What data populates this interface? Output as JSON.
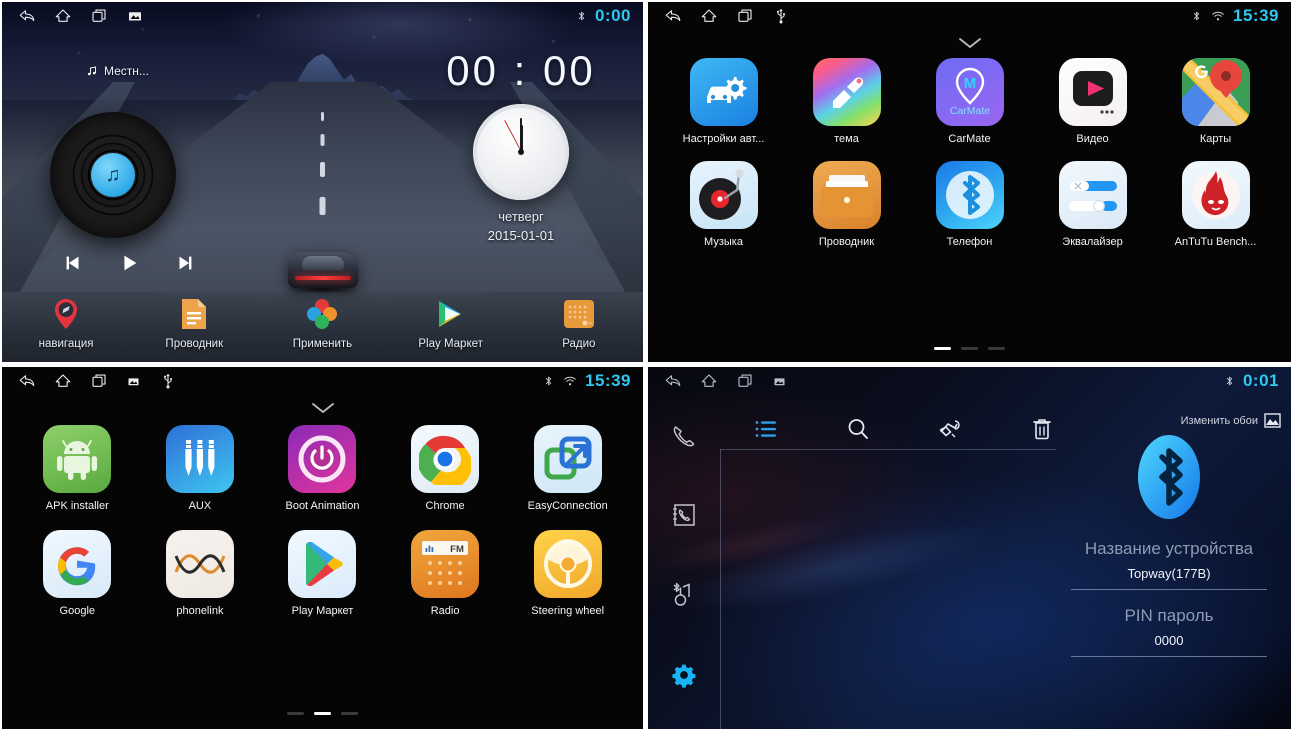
{
  "panels": {
    "home": {
      "statusbar": {
        "left_icons": [
          "back-icon",
          "home-icon",
          "recents-icon",
          "screenshot-icon"
        ],
        "right_icons": [
          "bluetooth-icon"
        ],
        "time": "0:00"
      },
      "now_playing": {
        "icon": "music-note-icon",
        "text": "Местн..."
      },
      "music_widget": {
        "disc_icon": "music-note-icon",
        "prev_label": "prev-track",
        "play_label": "play",
        "next_label": "next-track"
      },
      "clock_widget": {
        "digital_time": "00 : 00",
        "day_of_week": "четверг",
        "date": "2015-01-01"
      },
      "dock": [
        {
          "label": "навигация",
          "icon": "navigation-pin-icon"
        },
        {
          "label": "Проводник",
          "icon": "file-manager-icon"
        },
        {
          "label": "Применить",
          "icon": "apply-clover-icon"
        },
        {
          "label": "Play Маркет",
          "icon": "play-store-icon"
        },
        {
          "label": "Радио",
          "icon": "radio-icon"
        }
      ]
    },
    "drawer_page1": {
      "statusbar": {
        "left_icons": [
          "back-icon",
          "home-icon",
          "recents-icon",
          "usb-icon"
        ],
        "right_icons": [
          "bluetooth-icon",
          "wifi-icon"
        ],
        "time": "15:39"
      },
      "chevron": "chevron-down-icon",
      "apps": [
        {
          "label": "Настройки авт...",
          "icon": "car-settings-icon"
        },
        {
          "label": "тема",
          "icon": "theme-brush-icon"
        },
        {
          "label": "CarMate",
          "icon": "carmate-icon"
        },
        {
          "label": "Видео",
          "icon": "video-player-icon"
        },
        {
          "label": "Карты",
          "icon": "google-maps-icon"
        },
        {
          "label": "Музыка",
          "icon": "music-turntable-icon"
        },
        {
          "label": "Проводник",
          "icon": "file-manager-icon"
        },
        {
          "label": "Телефон",
          "icon": "bluetooth-phone-icon"
        },
        {
          "label": "Эквалайзер",
          "icon": "equalizer-icon"
        },
        {
          "label": "AnTuTu Bench...",
          "icon": "antutu-icon"
        }
      ],
      "pager": {
        "count": 3,
        "active": 0
      }
    },
    "drawer_page2": {
      "statusbar": {
        "left_icons": [
          "back-icon",
          "home-icon",
          "recents-icon",
          "screenshot-icon",
          "usb-icon"
        ],
        "right_icons": [
          "bluetooth-icon",
          "wifi-icon"
        ],
        "time": "15:39"
      },
      "chevron": "chevron-down-icon",
      "apps": [
        {
          "label": "APK installer",
          "icon": "android-icon"
        },
        {
          "label": "AUX",
          "icon": "aux-jack-icon"
        },
        {
          "label": "Boot Animation",
          "icon": "power-icon"
        },
        {
          "label": "Chrome",
          "icon": "chrome-icon"
        },
        {
          "label": "EasyConnection",
          "icon": "easyconnection-icon"
        },
        {
          "label": "Google",
          "icon": "google-g-icon"
        },
        {
          "label": "phonelink",
          "icon": "phonelink-icon"
        },
        {
          "label": "Play Маркет",
          "icon": "play-store-icon"
        },
        {
          "label": "Radio",
          "icon": "radio-fm-icon"
        },
        {
          "label": "Steering wheel",
          "icon": "steering-wheel-icon"
        }
      ],
      "pager": {
        "count": 3,
        "active": 1
      }
    },
    "bluetooth": {
      "statusbar": {
        "left_icons": [
          "back-icon",
          "home-icon",
          "recents-icon",
          "screenshot-icon"
        ],
        "right_icons": [
          "bluetooth-icon"
        ],
        "time": "0:01"
      },
      "toolbar": [
        {
          "name": "list-icon",
          "active": true
        },
        {
          "name": "search-icon",
          "active": false
        },
        {
          "name": "pair-hand-icon",
          "active": false
        },
        {
          "name": "trash-icon",
          "active": false
        }
      ],
      "wallpaper_button": {
        "label": "Изменить обои",
        "icon": "image-icon"
      },
      "sidebar": [
        {
          "name": "phone-dial-icon",
          "active": false
        },
        {
          "name": "contacts-book-icon",
          "active": false
        },
        {
          "name": "bluetooth-music-icon",
          "active": false
        },
        {
          "name": "settings-gear-icon",
          "active": true
        }
      ],
      "logo_icon": "bluetooth-logo-icon",
      "fields": [
        {
          "label": "Название устройства",
          "value": "Topway(177B)"
        },
        {
          "label": "PIN пароль",
          "value": "0000"
        }
      ]
    }
  },
  "colors": {
    "accent_cyan": "#2ec7f0",
    "bt_blue": "#29b6f6",
    "drawer_bg": "#050505"
  }
}
